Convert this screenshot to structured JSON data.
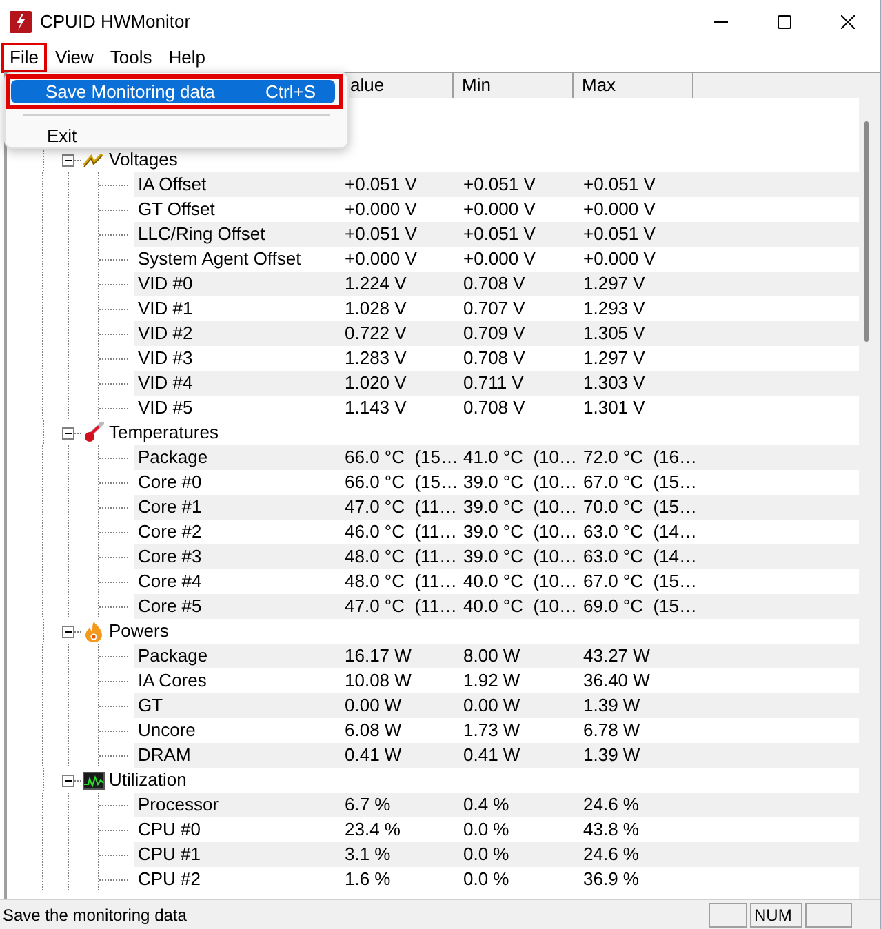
{
  "window": {
    "title": "CPUID HWMonitor"
  },
  "menu_bar": [
    {
      "label": "File",
      "selected": true
    },
    {
      "label": "View",
      "selected": false
    },
    {
      "label": "Tools",
      "selected": false
    },
    {
      "label": "Help",
      "selected": false
    }
  ],
  "open_menu": {
    "items": [
      {
        "kind": "item",
        "label": "Save Monitoring data",
        "shortcut": "Ctrl+S",
        "selected": true
      },
      {
        "kind": "separator"
      },
      {
        "kind": "item",
        "label": "Exit",
        "selected": false
      }
    ]
  },
  "columns": [
    "alue",
    "Min",
    "Max"
  ],
  "tree": [
    {
      "kind": "voltage",
      "label": "Voltages",
      "expanded": true,
      "children": [
        {
          "label": "IA Offset",
          "value": "+0.051 V",
          "min": "+0.051 V",
          "max": "+0.051 V"
        },
        {
          "label": "GT Offset",
          "value": "+0.000 V",
          "min": "+0.000 V",
          "max": "+0.000 V"
        },
        {
          "label": "LLC/Ring Offset",
          "value": "+0.051 V",
          "min": "+0.051 V",
          "max": "+0.051 V"
        },
        {
          "label": "System Agent Offset",
          "value": "+0.000 V",
          "min": "+0.000 V",
          "max": "+0.000 V"
        },
        {
          "label": "VID #0",
          "value": "1.224 V",
          "min": "0.708 V",
          "max": "1.297 V"
        },
        {
          "label": "VID #1",
          "value": "1.028 V",
          "min": "0.707 V",
          "max": "1.293 V"
        },
        {
          "label": "VID #2",
          "value": "0.722 V",
          "min": "0.709 V",
          "max": "1.305 V"
        },
        {
          "label": "VID #3",
          "value": "1.283 V",
          "min": "0.708 V",
          "max": "1.297 V"
        },
        {
          "label": "VID #4",
          "value": "1.020 V",
          "min": "0.711 V",
          "max": "1.303 V"
        },
        {
          "label": "VID #5",
          "value": "1.143 V",
          "min": "0.708 V",
          "max": "1.301 V"
        }
      ]
    },
    {
      "kind": "temperature",
      "label": "Temperatures",
      "expanded": true,
      "children": [
        {
          "label": "Package",
          "value": "66.0 °C  (15…",
          "min": "41.0 °C  (10…",
          "max": "72.0 °C  (16…"
        },
        {
          "label": "Core #0",
          "value": "66.0 °C  (15…",
          "min": "39.0 °C  (10…",
          "max": "67.0 °C  (15…"
        },
        {
          "label": "Core #1",
          "value": "47.0 °C  (11…",
          "min": "39.0 °C  (10…",
          "max": "70.0 °C  (15…"
        },
        {
          "label": "Core #2",
          "value": "46.0 °C  (11…",
          "min": "39.0 °C  (10…",
          "max": "63.0 °C  (14…"
        },
        {
          "label": "Core #3",
          "value": "48.0 °C  (11…",
          "min": "39.0 °C  (10…",
          "max": "63.0 °C  (14…"
        },
        {
          "label": "Core #4",
          "value": "48.0 °C  (11…",
          "min": "40.0 °C  (10…",
          "max": "67.0 °C  (15…"
        },
        {
          "label": "Core #5",
          "value": "47.0 °C  (11…",
          "min": "40.0 °C  (10…",
          "max": "69.0 °C  (15…"
        }
      ]
    },
    {
      "kind": "power",
      "label": "Powers",
      "expanded": true,
      "children": [
        {
          "label": "Package",
          "value": "16.17 W",
          "min": "8.00 W",
          "max": "43.27 W"
        },
        {
          "label": "IA Cores",
          "value": "10.08 W",
          "min": "1.92 W",
          "max": "36.40 W"
        },
        {
          "label": "GT",
          "value": "0.00 W",
          "min": "0.00 W",
          "max": "1.39 W"
        },
        {
          "label": "Uncore",
          "value": "6.08 W",
          "min": "1.73 W",
          "max": "6.78 W"
        },
        {
          "label": "DRAM",
          "value": "0.41 W",
          "min": "0.41 W",
          "max": "1.39 W"
        }
      ]
    },
    {
      "kind": "utilization",
      "label": "Utilization",
      "expanded": true,
      "children": [
        {
          "label": "Processor",
          "value": "6.7 %",
          "min": "0.4 %",
          "max": "24.6 %"
        },
        {
          "label": "CPU #0",
          "value": "23.4 %",
          "min": "0.0 %",
          "max": "43.8 %"
        },
        {
          "label": "CPU #1",
          "value": "3.1 %",
          "min": "0.0 %",
          "max": "24.6 %"
        },
        {
          "label": "CPU #2",
          "value": "1.6 %",
          "min": "0.0 %",
          "max": "36.9 %"
        }
      ]
    }
  ],
  "status_bar": {
    "text": "Save the monitoring data",
    "indicator": "NUM"
  }
}
